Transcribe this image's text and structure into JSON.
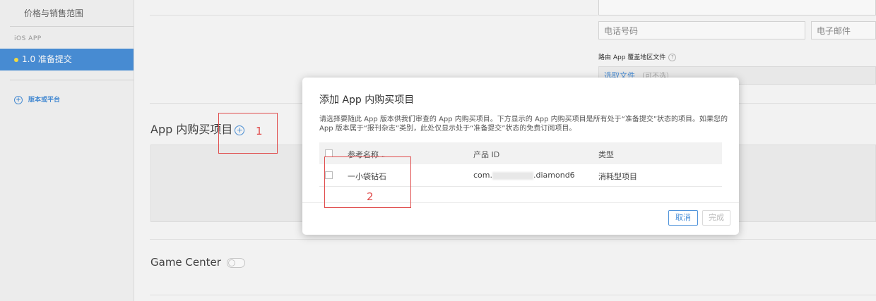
{
  "sidebar": {
    "price_item": "价格与销售范围",
    "section_label": "iOS APP",
    "active_version": "1.0 准备提交",
    "add_version": "版本或平台"
  },
  "contact": {
    "phone_placeholder": "电话号码",
    "email_placeholder": "电子邮件"
  },
  "routing": {
    "label": "路由 App 覆盖地区文件",
    "help_icon": "?",
    "choose_file": "选取文件",
    "optional": "（可不选）"
  },
  "sections": {
    "iap_title": "App 内购买项目",
    "game_center_title": "Game Center"
  },
  "modal": {
    "title": "添加 App 内购买项目",
    "description": "请选择要随此 App 版本供我们审查的 App 内购买项目。下方显示的 App 内购买项目是所有处于“准备提交”状态的项目。如果您的 App 版本属于“报刊杂志”类别，此处仅显示处于“准备提交”状态的免费订阅项目。",
    "columns": [
      "参考名称",
      "产品 ID",
      "类型"
    ],
    "rows": [
      {
        "name": "一小袋钻石",
        "product_id_prefix": "com.",
        "product_id_suffix": ".diamond6",
        "type": "消耗型项目"
      }
    ],
    "cancel_label": "取消",
    "done_label": "完成"
  },
  "annotations": {
    "one": "1",
    "two": "2"
  },
  "colors": {
    "accent": "#4a90d9",
    "annotation": "#e04b4b",
    "status_dot": "#f7e046"
  }
}
